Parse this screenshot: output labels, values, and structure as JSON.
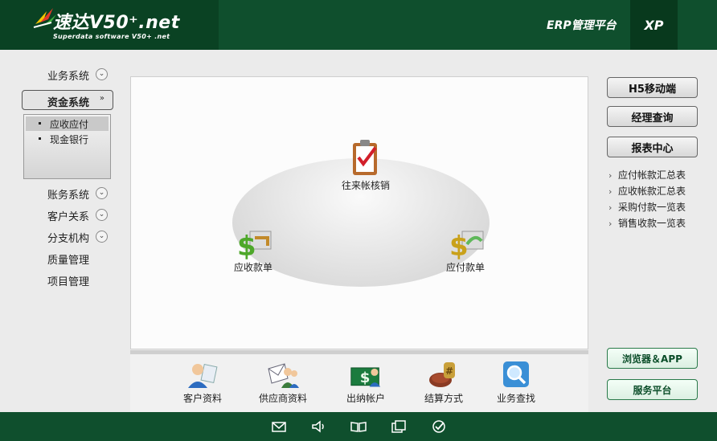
{
  "header": {
    "logo_text": "速达V50⁺.net",
    "logo_subtitle": "Superdata software V50+ .net",
    "platform_title": "ERP管理平台",
    "edition": "XP"
  },
  "leftnav": {
    "items": [
      {
        "label": "业务系统",
        "expandable": true
      },
      {
        "label": "资金系统",
        "expandable": true,
        "active": true
      },
      {
        "label": "账务系统",
        "expandable": true
      },
      {
        "label": "客户关系",
        "expandable": true
      },
      {
        "label": "分支机构",
        "expandable": true
      },
      {
        "label": "质量管理",
        "expandable": false
      },
      {
        "label": "项目管理",
        "expandable": false
      }
    ],
    "subitems": [
      {
        "label": "应收应付",
        "selected": true
      },
      {
        "label": "现金银行",
        "selected": false
      }
    ]
  },
  "flow": {
    "nodes": [
      {
        "label": "往来帐核销",
        "icon": "clipboard-check-icon"
      },
      {
        "label": "应收款单",
        "icon": "money-receive-icon"
      },
      {
        "label": "应付款单",
        "icon": "money-pay-icon"
      }
    ]
  },
  "quickbar": {
    "items": [
      {
        "label": "客户资料",
        "icon": "customer-icon"
      },
      {
        "label": "供应商资料",
        "icon": "supplier-icon"
      },
      {
        "label": "出纳帐户",
        "icon": "cashier-account-icon"
      },
      {
        "label": "结算方式",
        "icon": "settlement-icon"
      },
      {
        "label": "业务查找",
        "icon": "search-icon"
      }
    ]
  },
  "rightcol": {
    "buttons": [
      {
        "label": "H5移动端"
      },
      {
        "label": "经理查询"
      },
      {
        "label": "报表中心"
      }
    ],
    "links": [
      {
        "label": "应付帐款汇总表"
      },
      {
        "label": "应收帐款汇总表"
      },
      {
        "label": "采购付款一览表"
      },
      {
        "label": "销售收款一览表"
      }
    ],
    "bottom_buttons": [
      {
        "label": "浏览器＆APP"
      },
      {
        "label": "服务平台"
      }
    ]
  },
  "footer": {
    "icons": [
      "mail-icon",
      "speaker-icon",
      "book-icon",
      "documents-icon",
      "check-circle-icon"
    ]
  },
  "colors": {
    "header_green": "#0f4f2d",
    "logo_green": "#0a4223",
    "accent_green": "#2a7a4a"
  }
}
